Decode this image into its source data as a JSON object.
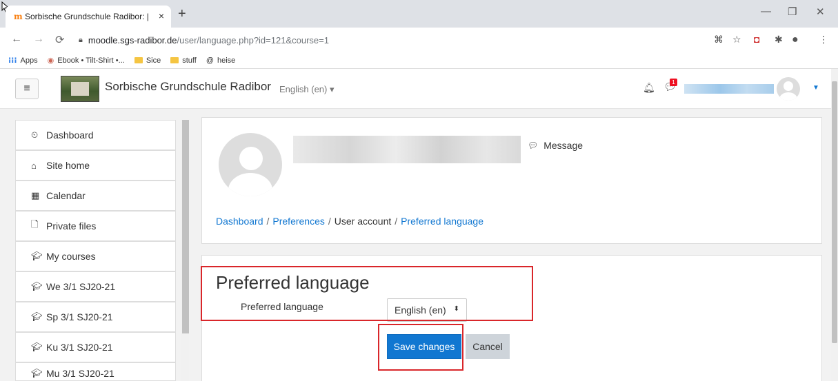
{
  "browser": {
    "tab_title": "Sorbische Grundschule Radibor: | ",
    "tab_close": "×",
    "new_tab": "+",
    "url_host": "moodle.sgs-radibor.de",
    "url_path": "/user/language.php?id=121&course=1",
    "bookmarks": [
      {
        "label": "Apps",
        "icon": "apps-grid-icon"
      },
      {
        "label": "Ebook • Tilt-Shirt •...",
        "icon": "ebook-favicon"
      },
      {
        "label": "Sice",
        "icon": "folder-icon"
      },
      {
        "label": "stuff",
        "icon": "folder-icon"
      },
      {
        "label": "heise",
        "icon": "heise-favicon"
      }
    ]
  },
  "navbar": {
    "site_name": "Sorbische Grundschule Radibor",
    "language": "English (en) ▾",
    "notification_count": "1"
  },
  "drawer": {
    "items": [
      {
        "label": "Dashboard",
        "icon": "dashboard-icon"
      },
      {
        "label": "Site home",
        "icon": "home-icon"
      },
      {
        "label": "Calendar",
        "icon": "calendar-icon"
      },
      {
        "label": "Private files",
        "icon": "file-icon"
      },
      {
        "label": "My courses",
        "icon": "graduation-cap-icon"
      },
      {
        "label": "We 3/1 SJ20-21",
        "icon": "graduation-cap-icon"
      },
      {
        "label": "Sp 3/1 SJ20-21",
        "icon": "graduation-cap-icon"
      },
      {
        "label": "Ku 3/1 SJ20-21",
        "icon": "graduation-cap-icon"
      },
      {
        "label": "Mu 3/1 SJ20-21",
        "icon": "graduation-cap-icon"
      }
    ]
  },
  "header": {
    "message_label": "Message",
    "breadcrumb": {
      "dashboard": "Dashboard",
      "preferences": "Preferences",
      "user_account": "User account",
      "preferred_language": "Preferred language",
      "separator": "/"
    }
  },
  "form": {
    "title": "Preferred language",
    "field_label": "Preferred language",
    "selected_value": "English (en)",
    "save_label": "Save changes",
    "cancel_label": "Cancel"
  },
  "colors": {
    "accent": "#1177d1",
    "highlight": "#d9262a",
    "notification": "#ee1122"
  }
}
